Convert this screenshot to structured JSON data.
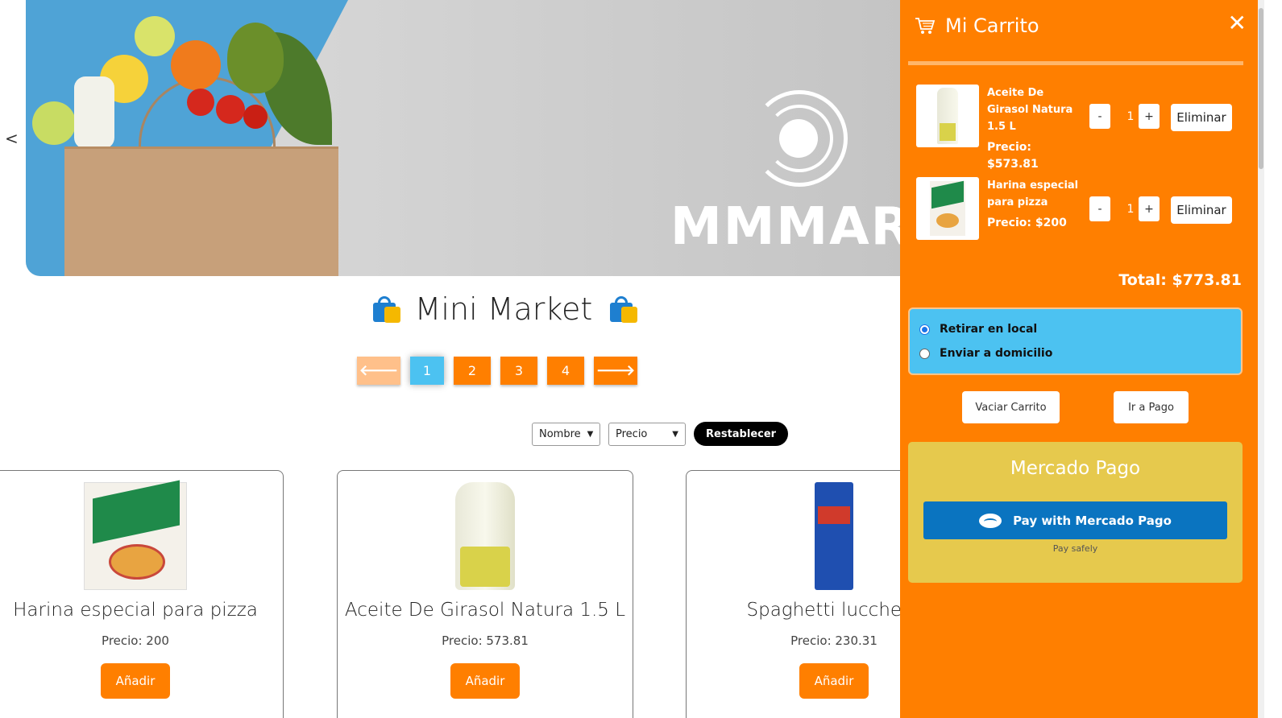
{
  "carousel": {
    "prev_label": "<",
    "brand_text": "MMMARKET"
  },
  "header": {
    "title": "Mini Market"
  },
  "pagination": {
    "prev_icon": "arrow-left-icon",
    "next_icon": "arrow-right-icon",
    "prev_glyph": "🡐",
    "next_glyph": "🡒",
    "pages": [
      "1",
      "2",
      "3",
      "4"
    ],
    "current": "1"
  },
  "filters": {
    "sort_name": "Nombre",
    "sort_price": "Precio",
    "reset_label": "Restablecer"
  },
  "products": [
    {
      "name": "Harina especial para pizza",
      "price": "Precio: 200",
      "button": "Añadir"
    },
    {
      "name": "Aceite De Girasol Natura 1.5 L",
      "price": "Precio: 573.81",
      "button": "Añadir"
    },
    {
      "name": "Spaghetti lucchetti",
      "price": "Precio: 230.31",
      "button": "Añadir"
    }
  ],
  "cart": {
    "title": "Mi Carrito",
    "close_glyph": "✕",
    "items": [
      {
        "name": "Aceite De Girasol Natura 1.5 L",
        "price": "Precio: $573.81",
        "qty": "1",
        "minus": "-",
        "plus": "+",
        "remove": "Eliminar"
      },
      {
        "name": "Harina especial para pizza",
        "price": "Precio: $200",
        "qty": "1",
        "minus": "-",
        "plus": "+",
        "remove": "Eliminar"
      }
    ],
    "total": "Total: $773.81",
    "delivery": {
      "pickup": "Retirar en local",
      "home": "Enviar a domicilio",
      "selected": "Retirar en local"
    },
    "empty_label": "Vaciar Carrito",
    "pay_label": "Ir a Pago"
  },
  "mercado_pago": {
    "title": "Mercado Pago",
    "button": "Pay with Mercado Pago",
    "subtitle": "Pay safely"
  },
  "colors": {
    "accent": "#ff7f00",
    "active_page": "#4cc2f1",
    "mp_panel": "#e6c94d",
    "mp_button": "#0a74c0"
  }
}
